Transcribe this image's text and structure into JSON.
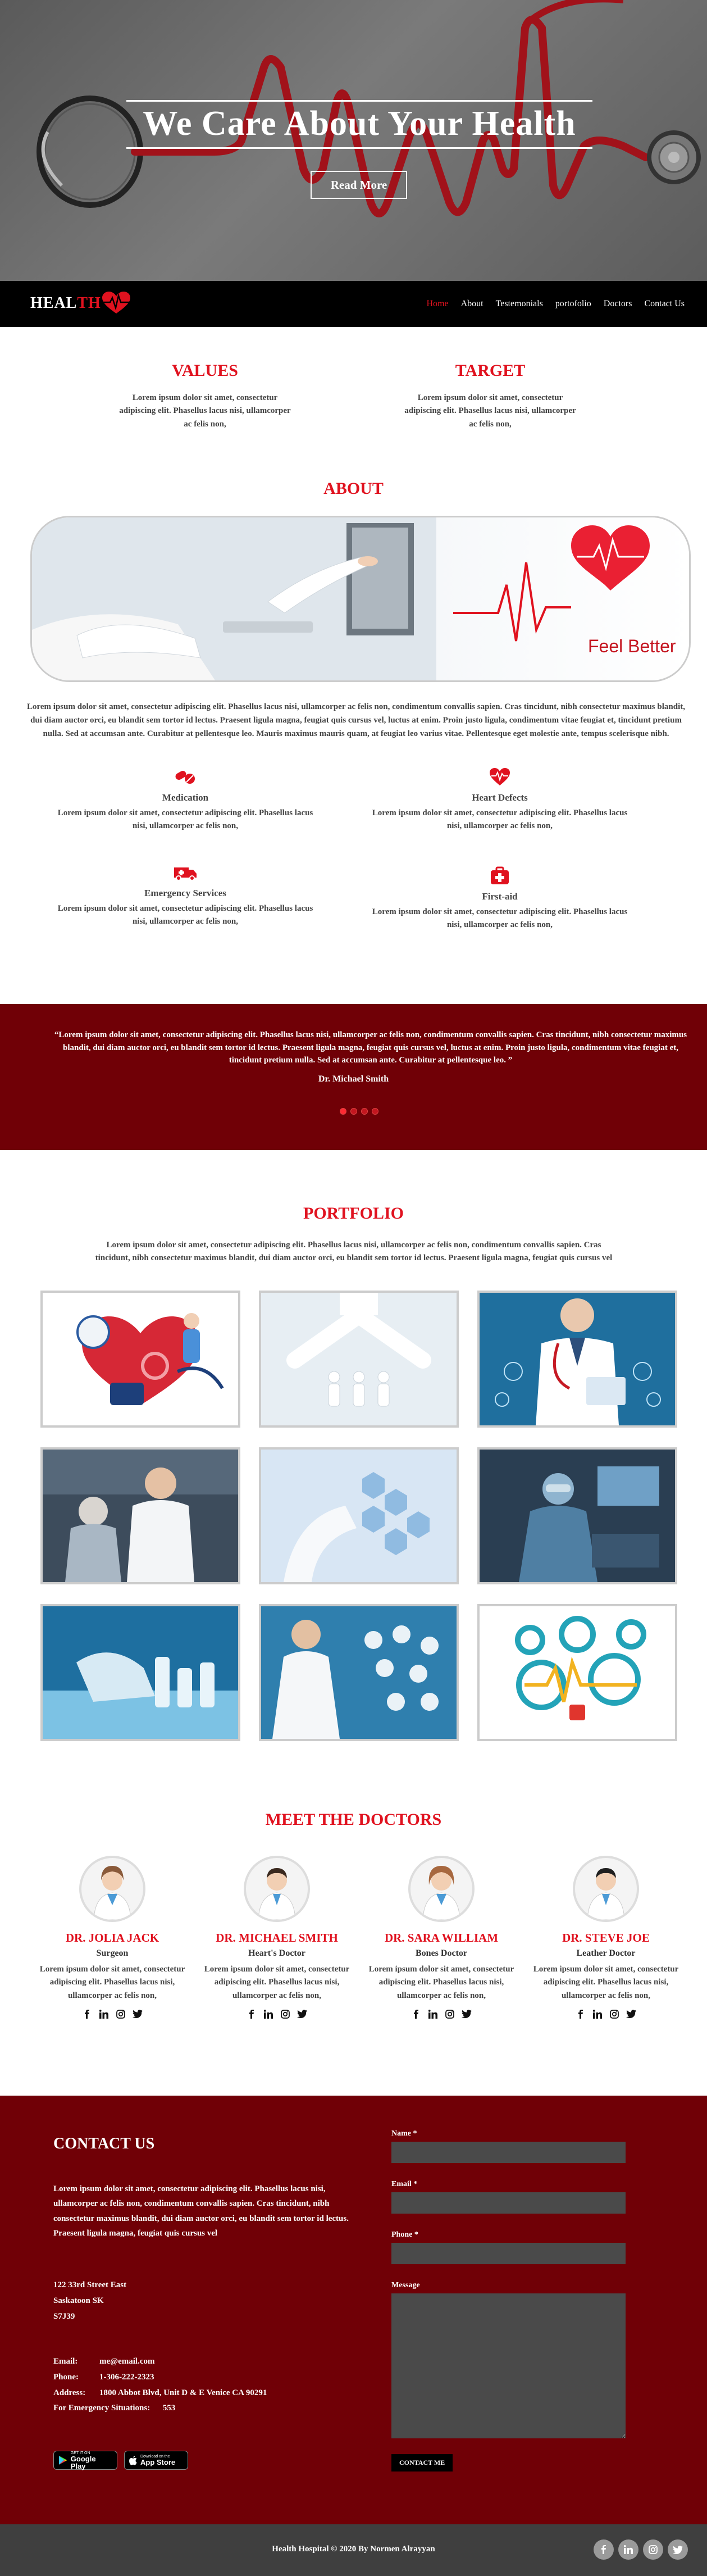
{
  "hero": {
    "title": "We Care About Your Health",
    "button": "Read More"
  },
  "nav": {
    "logo_a": "HEAL",
    "logo_b": "TH",
    "links": [
      "Home",
      "About",
      "Testemonials",
      "portofolio",
      "Doctors",
      "Contact Us"
    ]
  },
  "values": {
    "title": "VALUES",
    "text": "Lorem ipsum dolor sit amet, consectetur adipiscing elit. Phasellus lacus nisi, ullamcorper ac felis non,"
  },
  "target": {
    "title": "TARGET",
    "text": "Lorem ipsum dolor sit amet, consectetur adipiscing elit. Phasellus lacus nisi, ullamcorper ac felis non,"
  },
  "about": {
    "title": "ABOUT",
    "banner_text": "Feel Better",
    "paragraph": "Lorem ipsum dolor sit amet, consectetur adipiscing elit. Phasellus lacus nisi, ullamcorper ac felis non, condimentum convallis sapien. Cras tincidunt, nibh consectetur maximus blandit, dui diam auctor orci, eu blandit sem tortor id lectus. Praesent ligula magna, feugiat quis cursus vel, luctus at enim. Proin justo ligula, condimentum vitae feugiat et, tincidunt pretium nulla. Sed at accumsan ante. Curabitur at pellentesque leo. Mauris maximus mauris quam, at feugiat leo varius vitae. Pellentesque eget molestie ante, tempus scelerisque nibh.",
    "features": [
      {
        "title": "Medication",
        "text": "Lorem ipsum dolor sit amet, consectetur adipiscing elit. Phasellus lacus nisi, ullamcorper ac felis non,",
        "icon": "pills-icon"
      },
      {
        "title": "Heart Defects",
        "text": "Lorem ipsum dolor sit amet, consectetur adipiscing elit. Phasellus lacus nisi, ullamcorper ac felis non,",
        "icon": "heartbeat-icon"
      },
      {
        "title": "Emergency Services",
        "text": "Lorem ipsum dolor sit amet, consectetur adipiscing elit. Phasellus lacus nisi, ullamcorper ac felis non,",
        "icon": "ambulance-icon"
      },
      {
        "title": "First-aid",
        "text": "Lorem ipsum dolor sit amet, consectetur adipiscing elit. Phasellus lacus nisi, ullamcorper ac felis non,",
        "icon": "first-aid-kit-icon"
      }
    ]
  },
  "testimonial": {
    "quote": "“Lorem ipsum dolor sit amet, consectetur adipiscing elit. Phasellus lacus nisi, ullamcorper ac felis non, condimentum convallis sapien. Cras tincidunt, nibh consectetur maximus blandit, dui diam auctor orci, eu blandit sem tortor id lectus. Praesent ligula magna, feugiat quis cursus vel, luctus at enim. Proin justo ligula, condimentum vitae feugiat et, tincidunt pretium nulla. Sed at accumsan ante. Curabitur at pellentesque leo. ”",
    "author": "Dr. Michael Smith"
  },
  "portfolio": {
    "title": "PORTFOLIO",
    "text": "Lorem ipsum dolor sit amet, consectetur adipiscing elit. Phasellus lacus nisi, ullamcorper ac felis non, condimentum convallis sapien. Cras tincidunt, nibh consectetur maximus blandit, dui diam auctor orci, eu blandit sem tortor id lectus. Praesent ligula magna, feugiat quis cursus vel"
  },
  "doctors": {
    "title": "MEET THE DOCTORS",
    "list": [
      {
        "name": "DR. JOLIA JACK",
        "role": "Surgeon",
        "text": "Lorem ipsum dolor sit amet, consectetur adipiscing elit. Phasellus lacus nisi, ullamcorper ac felis non,"
      },
      {
        "name": "DR. MICHAEL SMITH",
        "role": "Heart's Doctor",
        "text": "Lorem ipsum dolor sit amet, consectetur adipiscing elit. Phasellus lacus nisi, ullamcorper ac felis non,"
      },
      {
        "name": "DR. SARA WILLIAM",
        "role": "Bones Doctor",
        "text": "Lorem ipsum dolor sit amet, consectetur adipiscing elit. Phasellus lacus nisi, ullamcorper ac felis non,"
      },
      {
        "name": "DR. STEVE JOE",
        "role": "Leather Doctor",
        "text": "Lorem ipsum dolor sit amet, consectetur adipiscing elit. Phasellus lacus nisi, ullamcorper ac felis non,"
      }
    ]
  },
  "footer": {
    "title": "CONTACT US",
    "intro": "Lorem ipsum dolor sit amet, consectetur adipiscing elit. Phasellus lacus nisi, ullamcorper ac felis non, condimentum convallis sapien. Cras tincidunt, nibh consectetur maximus blandit, dui diam auctor orci, eu blandit sem tortor id lectus. Praesent ligula magna, feugiat quis cursus vel",
    "address_lines": [
      "122 33rd Street East",
      "Saskatoon SK",
      "S7J39"
    ],
    "email_label": "Email:",
    "email": "me@email.com",
    "phone_label": "Phone:",
    "phone": "1-306-222-2323",
    "address_label": "Address:",
    "address": "1800 Abbot Blvd, Unit D & E Venice CA 90291",
    "emergency_label": "For Emergency Situations:",
    "emergency": "553",
    "google_play": "Google Play",
    "google_play_small": "GET IT ON",
    "app_store": "App Store",
    "app_store_small": "Download on the",
    "form": {
      "name": "Name *",
      "email": "Email *",
      "phone": "Phone *",
      "message": "Message",
      "submit": "CONTACT ME"
    }
  },
  "bottom": {
    "copyright": "Health Hospital © 2020 By Normen Alrayyan"
  }
}
